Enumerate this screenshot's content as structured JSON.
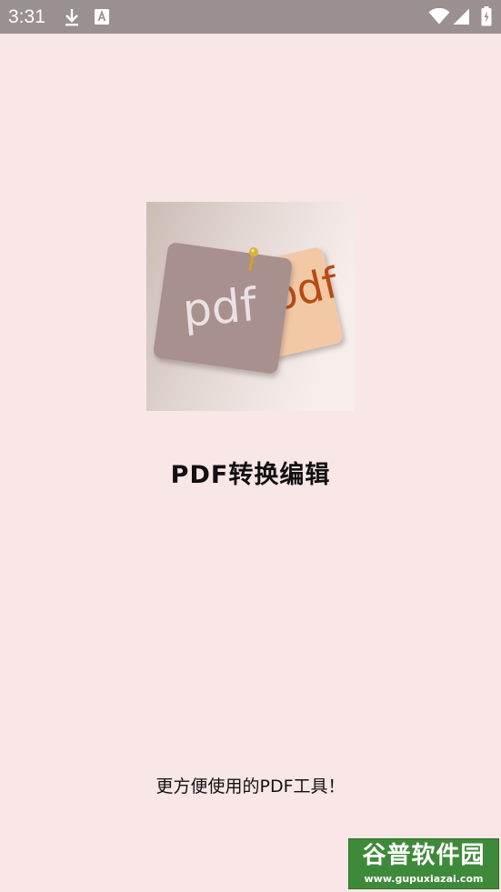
{
  "status_bar": {
    "time": "3:31",
    "icons": [
      "download-icon",
      "keyboard-a-icon",
      "wifi-icon",
      "signal-icon",
      "battery-charging-icon"
    ]
  },
  "splash": {
    "logo": {
      "back_card_text": "pdf",
      "front_card_text": "pdf"
    },
    "title": "PDF转换编辑",
    "slogan": "更方便使用的PDF工具！"
  },
  "watermark": {
    "title": "谷普软件园",
    "url": "www.gupuxiazai.com"
  },
  "colors": {
    "background": "#f9e6e6",
    "status_bar": "#9a9090",
    "back_card": "#f3c9a5",
    "back_card_text": "#b84a14",
    "front_card": "#a8908f",
    "front_card_text": "#e9e2e2",
    "pin": "#d8b43a",
    "watermark": "#3e8a3a"
  }
}
